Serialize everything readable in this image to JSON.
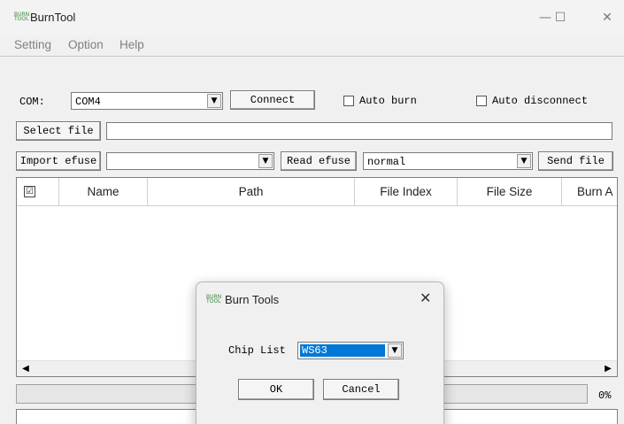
{
  "window": {
    "title": "BurnTool",
    "icon_text": "BURN TOOL",
    "minimize": "—",
    "maximize": "☐",
    "close": "✕"
  },
  "menu": [
    "Setting",
    "Option",
    "Help"
  ],
  "toolbar": {
    "com_label": "COM:",
    "com_value": "COM4",
    "connect_label": "Connect",
    "auto_burn_label": "Auto burn",
    "auto_disconnect_label": "Auto disconnect",
    "select_file_label": "Select file",
    "file_path": "",
    "import_efuse_label": "Import efuse",
    "efuse_value": "",
    "read_efuse_label": "Read efuse",
    "mode_value": "normal",
    "send_file_label": "Send file"
  },
  "table": {
    "columns": [
      "Name",
      "Path",
      "File Index",
      "File Size",
      "Burn A"
    ],
    "rows": []
  },
  "progress": {
    "percent_label": "0%",
    "value": 0
  },
  "dialog": {
    "title": "Burn Tools",
    "chip_list_label": "Chip List",
    "chip_value": "WS63",
    "ok_label": "OK",
    "cancel_label": "Cancel"
  },
  "icons": {
    "dropdown": "▼",
    "scroll_left": "◀",
    "scroll_right": "▶",
    "header_check": "☑"
  }
}
